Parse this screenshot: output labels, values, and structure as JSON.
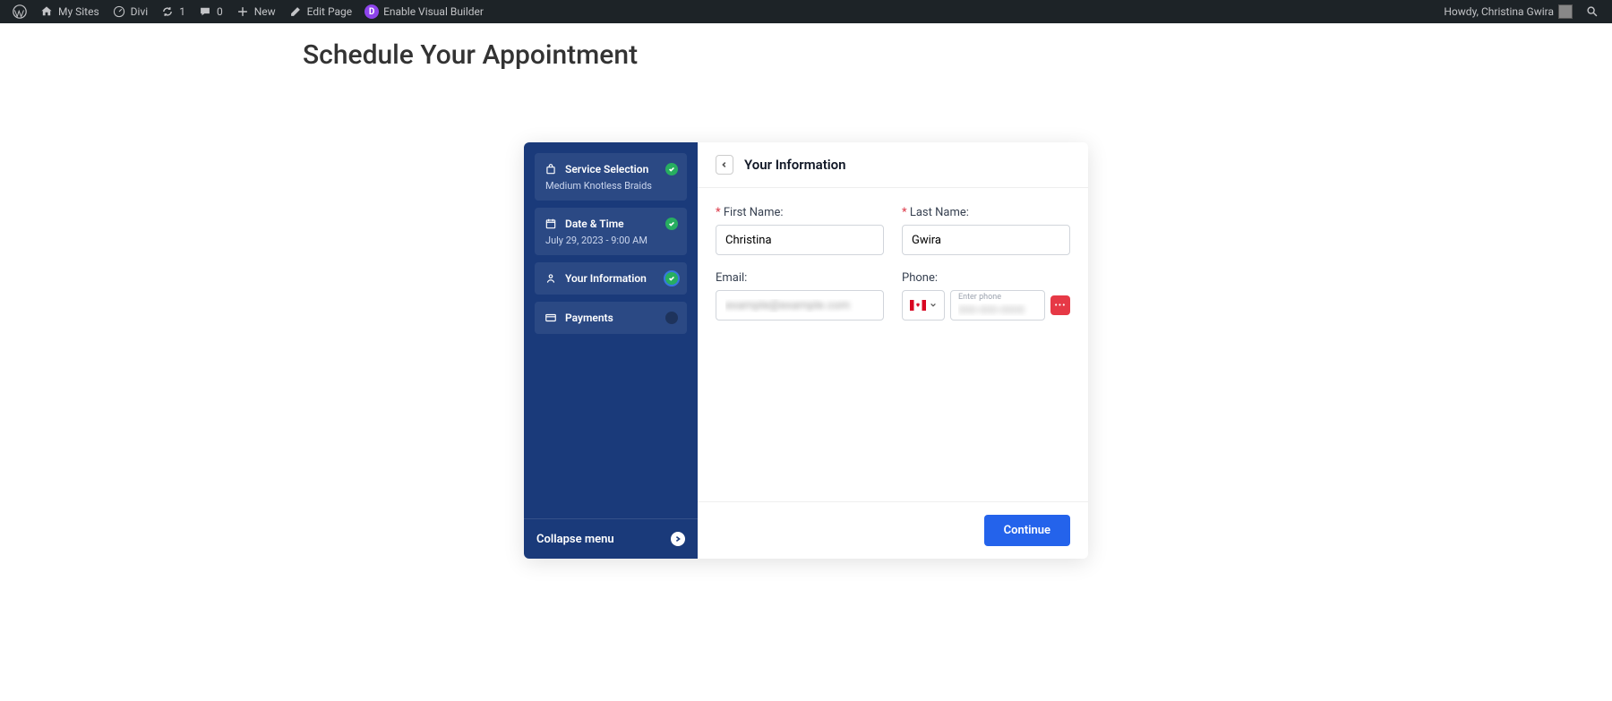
{
  "adminBar": {
    "mySites": "My Sites",
    "siteName": "Divi",
    "updates": "1",
    "comments": "0",
    "new": "New",
    "editPage": "Edit Page",
    "enableVB": "Enable Visual Builder",
    "greeting": "Howdy, Christina Gwira"
  },
  "pageTitle": "Schedule Your Appointment",
  "sidebar": {
    "steps": [
      {
        "title": "Service Selection",
        "sub": "Medium Knotless Braids"
      },
      {
        "title": "Date & Time",
        "sub": "July 29, 2023 - 9:00 AM"
      },
      {
        "title": "Your Information",
        "sub": ""
      },
      {
        "title": "Payments",
        "sub": ""
      }
    ],
    "collapse": "Collapse menu"
  },
  "main": {
    "title": "Your Information",
    "labels": {
      "firstName": "First Name:",
      "lastName": "Last Name:",
      "email": "Email:",
      "phone": "Phone:",
      "enterPhone": "Enter phone"
    },
    "values": {
      "firstName": "Christina",
      "lastName": "Gwira",
      "email": "example@example.com",
      "phone": "000-000-0000"
    },
    "continue": "Continue"
  }
}
